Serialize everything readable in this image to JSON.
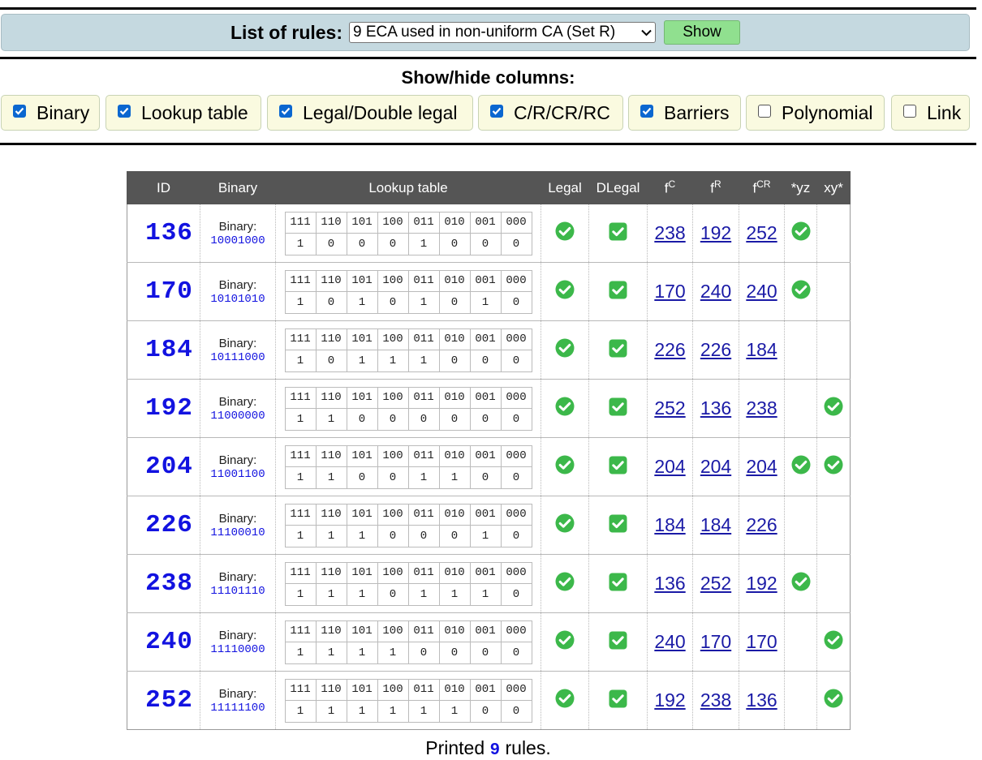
{
  "header": {
    "list_label": "List of rules:",
    "selected_rule_set": "9 ECA used in non-uniform CA (Set R)",
    "show_label": "Show"
  },
  "columns_panel": {
    "title": "Show/hide columns:",
    "toggles": [
      {
        "label": "Binary",
        "checked": true
      },
      {
        "label": "Lookup table",
        "checked": true
      },
      {
        "label": "Legal/Double legal",
        "checked": true
      },
      {
        "label": "C/R/CR/RC",
        "checked": true
      },
      {
        "label": "Barriers",
        "checked": true
      },
      {
        "label": "Polynomial",
        "checked": false
      },
      {
        "label": "Link",
        "checked": false
      }
    ]
  },
  "table": {
    "headers": {
      "id": "ID",
      "binary": "Binary",
      "lookup": "Lookup table",
      "legal": "Legal",
      "dlegal": "DLegal",
      "f": "f",
      "c": "C",
      "r": "R",
      "cr": "CR",
      "yz": "*yz",
      "xy": "xy*"
    },
    "binary_caption": "Binary:",
    "lut_patterns": [
      "111",
      "110",
      "101",
      "100",
      "011",
      "010",
      "001",
      "000"
    ],
    "rows": [
      {
        "id": "136",
        "binary": "10001000",
        "lut": [
          "1",
          "0",
          "0",
          "0",
          "1",
          "0",
          "0",
          "0"
        ],
        "legal": true,
        "dlegal": true,
        "fc": "238",
        "fr": "192",
        "fcr": "252",
        "yz": true,
        "xy": false
      },
      {
        "id": "170",
        "binary": "10101010",
        "lut": [
          "1",
          "0",
          "1",
          "0",
          "1",
          "0",
          "1",
          "0"
        ],
        "legal": true,
        "dlegal": true,
        "fc": "170",
        "fr": "240",
        "fcr": "240",
        "yz": true,
        "xy": false
      },
      {
        "id": "184",
        "binary": "10111000",
        "lut": [
          "1",
          "0",
          "1",
          "1",
          "1",
          "0",
          "0",
          "0"
        ],
        "legal": true,
        "dlegal": true,
        "fc": "226",
        "fr": "226",
        "fcr": "184",
        "yz": false,
        "xy": false
      },
      {
        "id": "192",
        "binary": "11000000",
        "lut": [
          "1",
          "1",
          "0",
          "0",
          "0",
          "0",
          "0",
          "0"
        ],
        "legal": true,
        "dlegal": true,
        "fc": "252",
        "fr": "136",
        "fcr": "238",
        "yz": false,
        "xy": true
      },
      {
        "id": "204",
        "binary": "11001100",
        "lut": [
          "1",
          "1",
          "0",
          "0",
          "1",
          "1",
          "0",
          "0"
        ],
        "legal": true,
        "dlegal": true,
        "fc": "204",
        "fr": "204",
        "fcr": "204",
        "yz": true,
        "xy": true
      },
      {
        "id": "226",
        "binary": "11100010",
        "lut": [
          "1",
          "1",
          "1",
          "0",
          "0",
          "0",
          "1",
          "0"
        ],
        "legal": true,
        "dlegal": true,
        "fc": "184",
        "fr": "184",
        "fcr": "226",
        "yz": false,
        "xy": false
      },
      {
        "id": "238",
        "binary": "11101110",
        "lut": [
          "1",
          "1",
          "1",
          "0",
          "1",
          "1",
          "1",
          "0"
        ],
        "legal": true,
        "dlegal": true,
        "fc": "136",
        "fr": "252",
        "fcr": "192",
        "yz": true,
        "xy": false
      },
      {
        "id": "240",
        "binary": "11110000",
        "lut": [
          "1",
          "1",
          "1",
          "1",
          "0",
          "0",
          "0",
          "0"
        ],
        "legal": true,
        "dlegal": true,
        "fc": "240",
        "fr": "170",
        "fcr": "170",
        "yz": false,
        "xy": true
      },
      {
        "id": "252",
        "binary": "11111100",
        "lut": [
          "1",
          "1",
          "1",
          "1",
          "1",
          "1",
          "0",
          "0"
        ],
        "legal": true,
        "dlegal": true,
        "fc": "192",
        "fr": "238",
        "fcr": "136",
        "yz": false,
        "xy": true
      }
    ]
  },
  "footer": {
    "prefix": "Printed",
    "count": "9",
    "suffix": "rules."
  },
  "colors": {
    "check_green": "#3cb84a",
    "link_blue": "#1a1aa6",
    "id_blue": "#1212e0",
    "header_bg": "#555555"
  }
}
